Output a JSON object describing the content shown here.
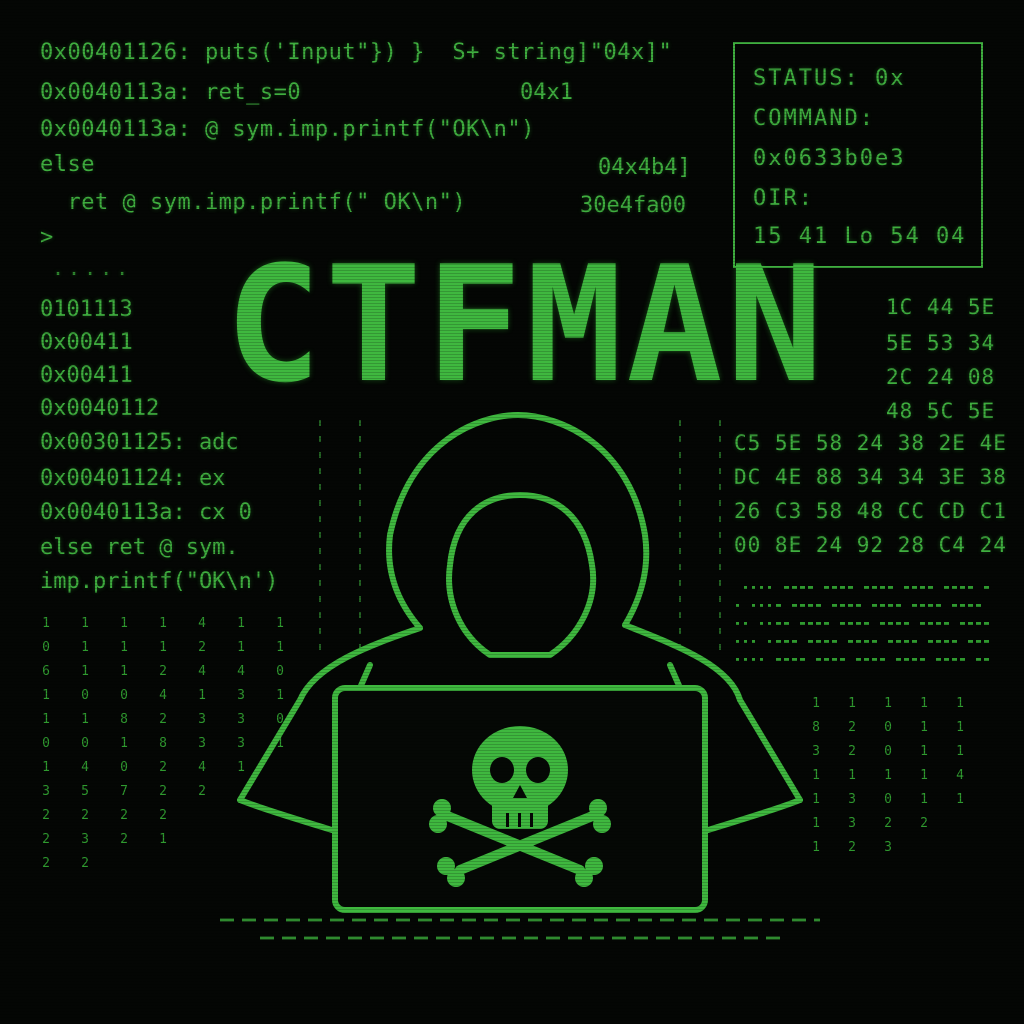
{
  "code_top": [
    "0x00401126: puts('Input\"}) }  S+ string]\"04x]\"",
    "0x0040113a: ret_s=0",
    "0x0040113a: @ sym.imp.printf(\"OK\\n\")",
    "else",
    "  ret @ sym.imp.printf(\" OK\\n\")",
    ">"
  ],
  "code_top_right": [
    "04x1",
    "04x4b4]",
    "30e4fa00"
  ],
  "dots_text": ".....",
  "status": {
    "line1": "STATUS: 0x",
    "line2": "COMMAND:",
    "line3": "0x0633b0e3",
    "line4": "OIR:",
    "line5": "15 41 Lo 54 04"
  },
  "title": "CTFMAN",
  "code_left_mid": [
    "0101113",
    "0x00411",
    "0x00411",
    "0x0040112",
    "0x00301125: adc",
    "0x00401124: ex",
    "0x0040113a: cx 0",
    "else ret @ sym.",
    "imp.printf(\"OK\\n')"
  ],
  "hex_right_top": [
    "1C 44 5E",
    "5E 53 34",
    "2C 24 08",
    "48 5C 5E"
  ],
  "hex_right_block": [
    "C5 5E 58 24 38 2E 4E",
    "DC 4E 88 34 34 3E 38",
    "26 C3 58 48 CC CD C1",
    "00 8E 24 92 28 C4 24"
  ],
  "digit_columns_left": [
    [
      "1",
      "0",
      "6",
      "1",
      "1",
      "0",
      "1",
      "3",
      "2",
      "2",
      "2"
    ],
    [
      "1",
      "1",
      "1",
      "0",
      "1",
      "0",
      "4",
      "5",
      "2",
      "3",
      "2"
    ],
    [
      "1",
      "1",
      "1",
      "0",
      "8",
      "1",
      "0",
      "7",
      "2",
      "2",
      ""
    ],
    [
      "1",
      "1",
      "2",
      "4",
      "2",
      "8",
      "2",
      "2",
      "2",
      "1",
      ""
    ],
    [
      "4",
      "2",
      "4",
      "1",
      "3",
      "3",
      "4",
      "2",
      "",
      ""
    ],
    [
      "1",
      "1",
      "4",
      "3",
      "3",
      "3",
      "1",
      "",
      ""
    ],
    [
      "1",
      "1",
      "0",
      "1",
      "0",
      "1",
      "",
      ""
    ]
  ],
  "digit_columns_right": [
    [
      "1",
      "8",
      "3",
      "1",
      "1",
      "1",
      "1"
    ],
    [
      "1",
      "2",
      "2",
      "1",
      "3",
      "3",
      "2"
    ],
    [
      "1",
      "0",
      "0",
      "1",
      "0",
      "2",
      "3"
    ],
    [
      "1",
      "1",
      "1",
      "1",
      "1",
      "2"
    ],
    [
      "1",
      "1",
      "1",
      "4",
      "1",
      ""
    ]
  ],
  "colors": {
    "background": "#040604",
    "phosphor_green": "#3fae3f",
    "bright_green": "#3fb83f"
  },
  "icons": {
    "hacker": "hooded-hacker-icon",
    "skull": "skull-crossbones-icon"
  }
}
